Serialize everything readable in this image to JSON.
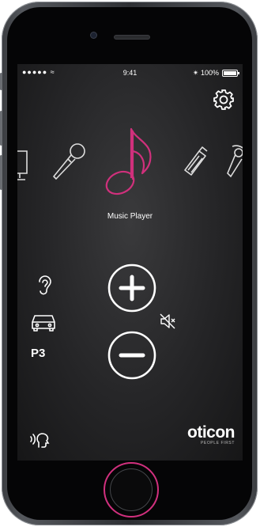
{
  "status_bar": {
    "signal": "●●●●● ",
    "time": "9:41",
    "battery_text": "100%"
  },
  "carousel": {
    "items": [
      "tv-icon",
      "microphone-icon",
      "music-note-icon",
      "phone-clip-icon",
      "tele-coil-icon"
    ],
    "selected_label": "Music Player",
    "accent_color": "#d0307c"
  },
  "controls": {
    "program": "P3"
  },
  "brand": {
    "name": "oticon",
    "tagline": "PEOPLE FIRST"
  },
  "colors": {
    "accent": "#d0307c",
    "screen_bg": "#252527",
    "icon": "#ffffff"
  }
}
